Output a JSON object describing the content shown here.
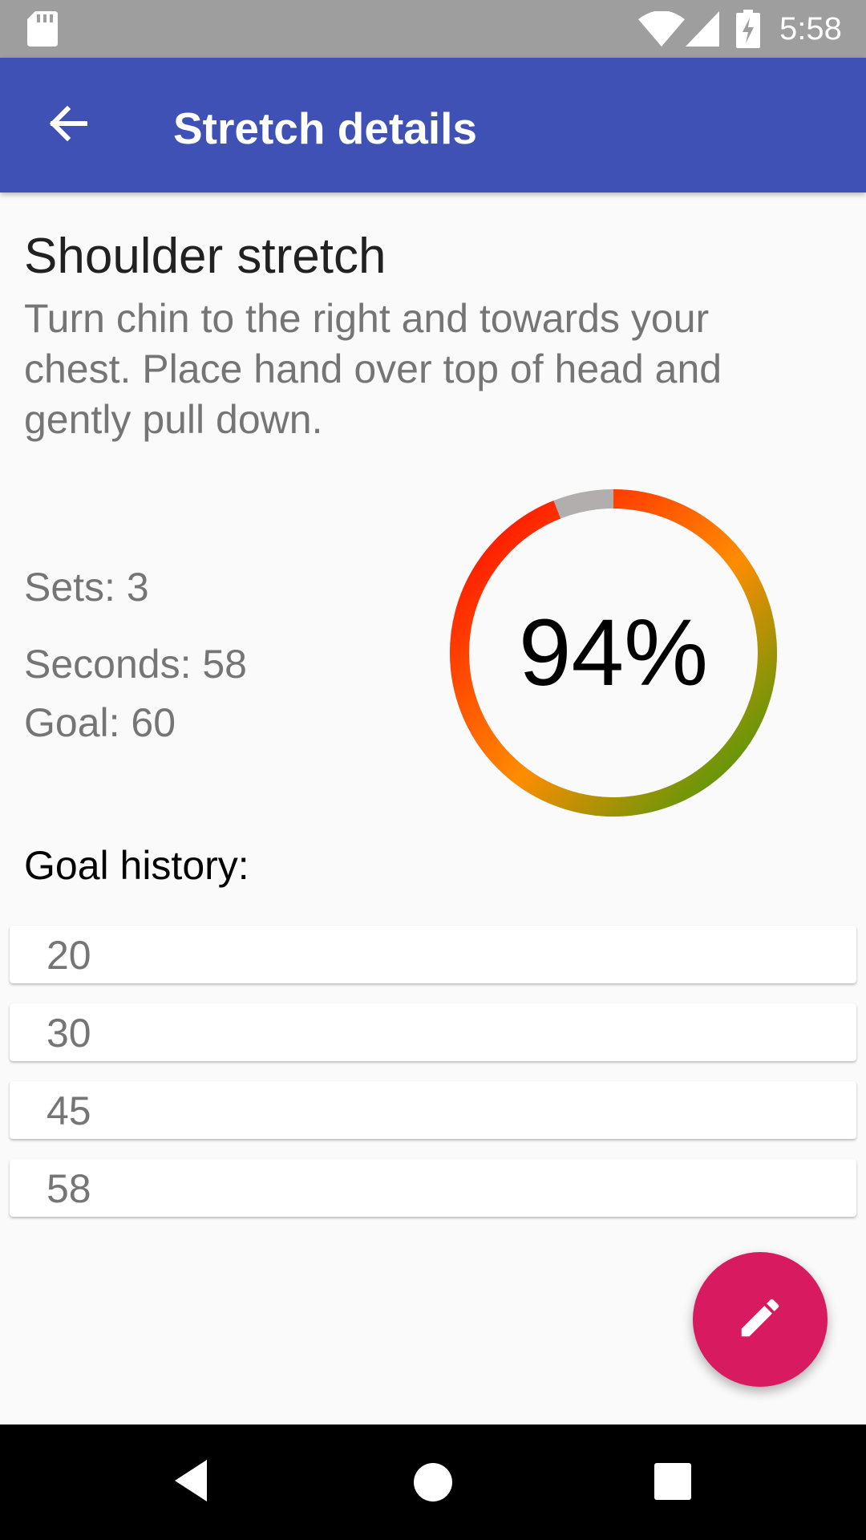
{
  "status_bar": {
    "time": "5:58",
    "icons": [
      "sd-card-icon",
      "wifi-icon",
      "signal-icon",
      "battery-charging-icon"
    ]
  },
  "app_bar": {
    "title": "Stretch details",
    "back_icon": "arrow-back-icon",
    "color": "#3f51b5"
  },
  "stretch": {
    "name": "Shoulder stretch",
    "description": "Turn chin to the right and towards your chest. Place hand over top of head and gently pull down."
  },
  "stats": {
    "sets": "Sets: 3",
    "seconds": "Seconds: 58",
    "goal": "Goal: 60"
  },
  "progress": {
    "label": "94%",
    "fraction": 0.94,
    "gradient_colors": [
      "#ff0000",
      "#ff8c00",
      "#2d9a0d"
    ],
    "remainder_color": "#b3aeae"
  },
  "history": {
    "label": "Goal history:",
    "values": [
      "20",
      "30",
      "45",
      "58"
    ]
  },
  "fab": {
    "icon": "pencil-icon",
    "color": "#d81b60"
  },
  "nav_bar": {
    "icons": [
      "nav-back-icon",
      "nav-home-icon",
      "nav-recents-icon"
    ]
  }
}
